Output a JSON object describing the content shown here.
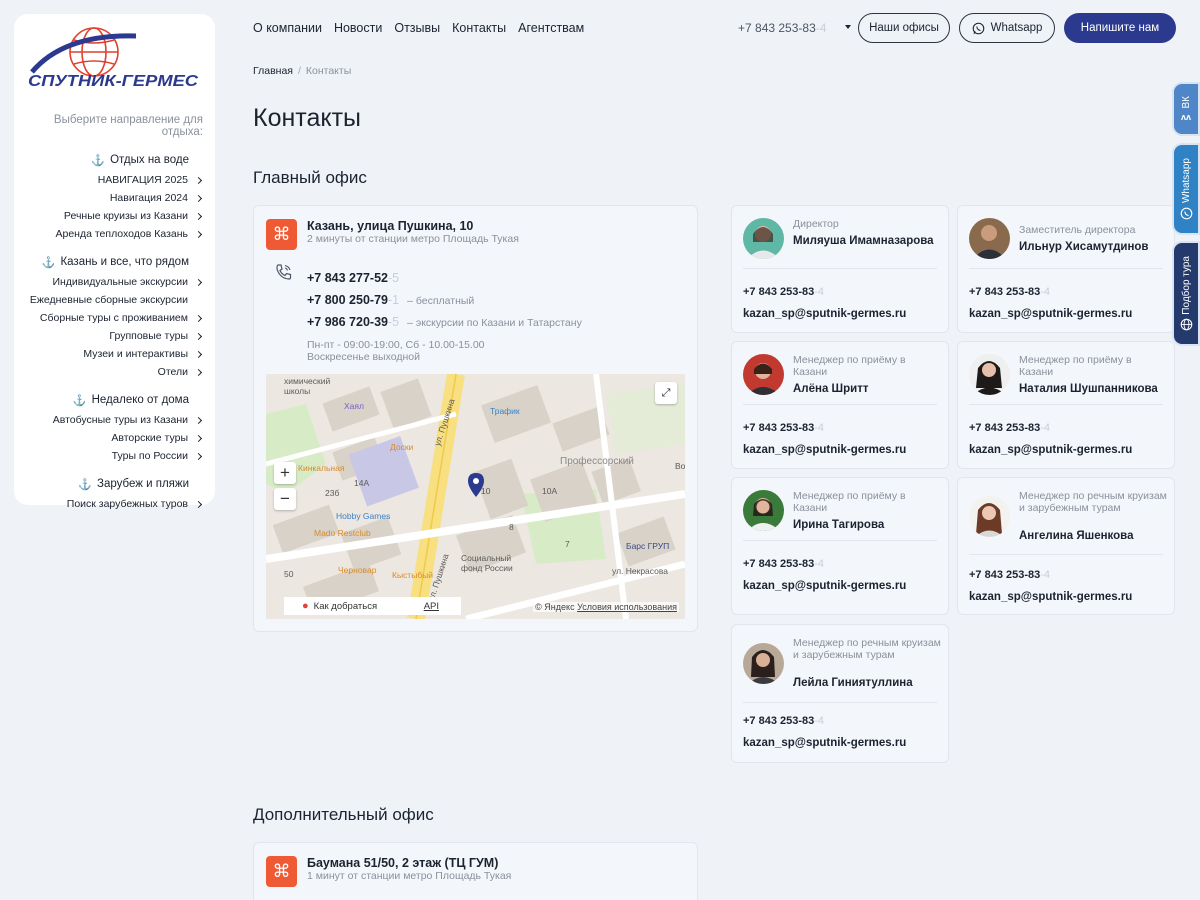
{
  "brand": {
    "logo_text": "СПУТНИК-ГЕРМЕС"
  },
  "sidebar": {
    "direction_title": "Выберите направление для отдыха:",
    "groups": [
      {
        "title": "Отдых на воде",
        "items": [
          "НАВИГАЦИЯ 2025",
          "Навигация 2024",
          "Речные круизы из Казани",
          "Аренда теплоходов Казань"
        ]
      },
      {
        "title": "Казань и все, что рядом",
        "items": [
          "Индивидуальные экскурсии",
          "Ежедневные сборные экскурсии",
          "Сборные туры с проживанием",
          "Групповые туры",
          "Музеи и интерактивы",
          "Отели"
        ]
      },
      {
        "title": "Недалеко от дома",
        "items": [
          "Автобусные туры из Казани",
          "Авторские туры",
          "Туры по России"
        ]
      },
      {
        "title": "Зарубеж и пляжи",
        "items": [
          "Поиск зарубежных туров"
        ]
      }
    ]
  },
  "nav": {
    "links": [
      "О компании",
      "Новости",
      "Отзывы",
      "Контакты",
      "Агентствам"
    ],
    "phone_main": "+7 843 253-83",
    "phone_fade": "-4",
    "offices_label": "Наши офисы",
    "whatsapp_label": "Whatsapp",
    "write_label": "Напишите нам"
  },
  "breadcrumb": {
    "home": "Главная",
    "current": "Контакты"
  },
  "page_title": "Контакты",
  "main_office": {
    "section_title": "Главный офис",
    "address": "Казань, улица Пушкина, 10",
    "subway": "2 минуты от станции метро Площадь Тукая",
    "phones": [
      {
        "main": "+7 843 277-52",
        "fade": "-5",
        "note": ""
      },
      {
        "main": "+7 800 250-79",
        "fade": "-1",
        "note": "– бесплатный"
      },
      {
        "main": "+7 986 720-39",
        "fade": "-5",
        "note": "– экскурсии по Казани и Татарстану"
      }
    ],
    "hours_1": "Пн-пт - 09:00-19:00, Сб - 10.00-15.00",
    "hours_2": "Воскресенье выходной"
  },
  "map": {
    "labels": [
      "химический",
      "школы",
      "Хаял",
      "Трафик",
      "Доски",
      "ул. Пушкина",
      "Профессорский",
      "Во",
      "Кинкальная",
      "14А",
      "23б",
      "10",
      "10А",
      "8",
      "Hobby Games",
      "Mado Restclub",
      "Социальный фонд России",
      "Барс ГРУП",
      "7",
      "ул. Некрасова",
      "Черновар",
      "Кыстыбый",
      "50",
      "ул. Пушкина"
    ],
    "route_label": "Как добраться",
    "api_label": "API",
    "copyright_prefix": "© Яндекс",
    "terms_label": "Условия использования"
  },
  "staff": [
    {
      "role": "Директор",
      "name": "Миляуша Имамназарова",
      "phone": "+7 843 253-83",
      "fade": "-4",
      "email": "kazan_sp@sputnik-germes.ru"
    },
    {
      "role": "Заместитель директора",
      "name": "Ильнур Хисамутдинов",
      "phone": "+7 843 253-83",
      "fade": "-4",
      "email": "kazan_sp@sputnik-germes.ru"
    },
    {
      "role": "Менеджер по приёму в Казани",
      "name": "Алёна Шритт",
      "phone": "+7 843 253-83",
      "fade": "-4",
      "email": "kazan_sp@sputnik-germes.ru"
    },
    {
      "role": "Менеджер по приёму в Казани",
      "name": "Наталия Шушпанникова",
      "phone": "+7 843 253-83",
      "fade": "-4",
      "email": "kazan_sp@sputnik-germes.ru"
    },
    {
      "role": "Менеджер по приёму в Казани",
      "name": "Ирина Тагирова",
      "phone": "+7 843 253-83",
      "fade": "-4",
      "email": "kazan_sp@sputnik-germes.ru"
    },
    {
      "role": "Менеджер по речным круизам и зарубежным турам",
      "name": "Ангелина Яшенкова",
      "phone": "+7 843 253-83",
      "fade": "-4",
      "email": "kazan_sp@sputnik-germes.ru"
    },
    {
      "role": "Менеджер по речным круизам и зарубежным турам",
      "name": "Лейла Гиниятуллина",
      "phone": "+7 843 253-83",
      "fade": "-4",
      "email": "kazan_sp@sputnik-germes.ru"
    }
  ],
  "second_office": {
    "section_title": "Дополнительный офис",
    "address": "Баумана 51/50, 2 этаж (ТЦ ГУМ)",
    "subway": "1 минут от станции метро Площадь Тукая"
  },
  "side_tabs": {
    "vk": "ВК",
    "whatsapp": "Whatsapp",
    "tour": "Подбор тура"
  },
  "colors": {
    "accent": "#ef5a34",
    "primary": "#2b3a8f",
    "background": "#eff3f8"
  }
}
